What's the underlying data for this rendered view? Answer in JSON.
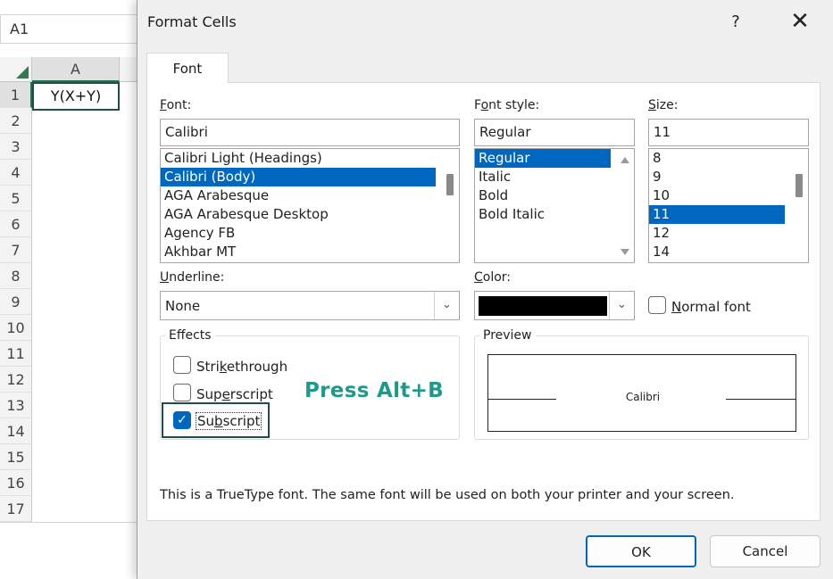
{
  "spreadsheet": {
    "name_box": "A1",
    "column_header": "A",
    "row_numbers": [
      "1",
      "2",
      "3",
      "4",
      "5",
      "6",
      "7",
      "8",
      "9",
      "10",
      "11",
      "12",
      "13",
      "14",
      "15",
      "16",
      "17"
    ],
    "cell_a1": "Y(X+Y)"
  },
  "dialog": {
    "title": "Format Cells",
    "help": "?",
    "close": "✕",
    "tab": "Font",
    "font": {
      "label_u": "F",
      "label_rest": "ont:",
      "value": "Calibri",
      "items": [
        "Calibri Light (Headings)",
        "Calibri (Body)",
        "AGA Arabesque",
        "AGA Arabesque Desktop",
        "Agency FB",
        "Akhbar MT"
      ],
      "selected": "Calibri (Body)"
    },
    "font_style": {
      "label_pre": "F",
      "label_u": "o",
      "label_rest": "nt style:",
      "value": "Regular",
      "items": [
        "Regular",
        "Italic",
        "Bold",
        "Bold Italic"
      ],
      "selected": "Regular"
    },
    "size": {
      "label_u": "S",
      "label_rest": "ize:",
      "value": "11",
      "items": [
        "8",
        "9",
        "10",
        "11",
        "12",
        "14"
      ],
      "selected": "11"
    },
    "underline": {
      "label_u": "U",
      "label_rest": "nderline:",
      "value": "None"
    },
    "color": {
      "label_u": "C",
      "label_rest": "olor:",
      "swatch": "#000000"
    },
    "normal_font": {
      "label_u": "N",
      "label_rest": "ormal font",
      "checked": false
    },
    "effects": {
      "title": "Effects",
      "strikethrough": {
        "pre": "Stri",
        "u": "k",
        "rest": "ethrough",
        "checked": false
      },
      "superscript": {
        "pre": "Sup",
        "u": "e",
        "rest": "rscript",
        "checked": false
      },
      "subscript": {
        "pre": "Su",
        "u": "b",
        "rest": "script",
        "checked": true
      }
    },
    "preview": {
      "title": "Preview",
      "sample": "Calibri"
    },
    "hint": "Press Alt+B",
    "footnote": "This is a TrueType font.  The same font will be used on both your printer and your screen.",
    "ok": "OK",
    "cancel": "Cancel"
  },
  "colors": {
    "selection": "#0067c0",
    "hint_text": "#1f9a8a",
    "focus_outline": "#1f4e4a",
    "excel_green": "#217346"
  }
}
